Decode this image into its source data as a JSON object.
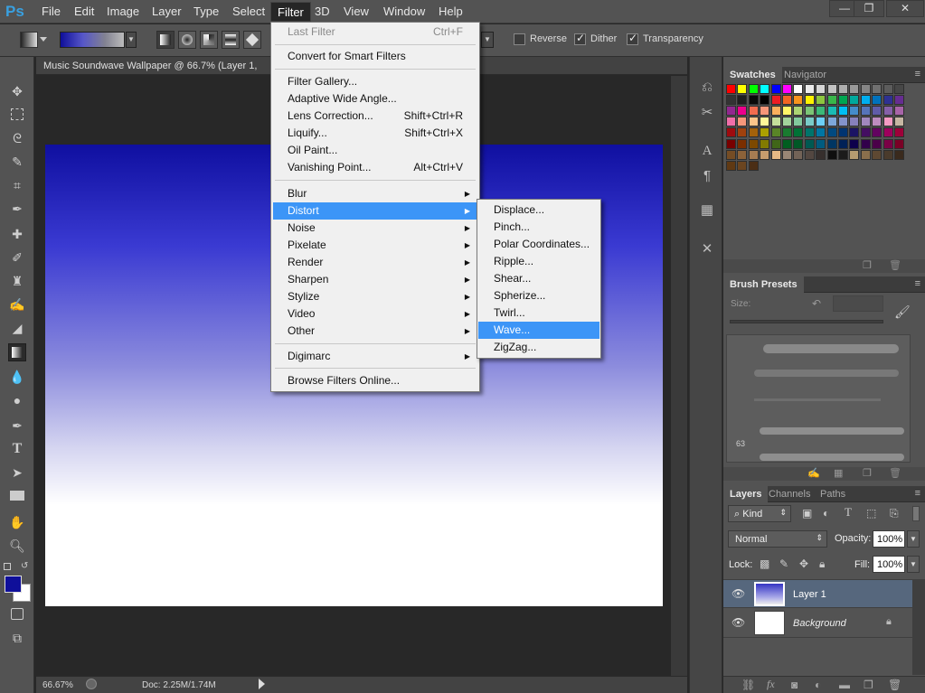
{
  "app": {
    "logo": "Ps"
  },
  "menubar": {
    "items": [
      "File",
      "Edit",
      "Image",
      "Layer",
      "Type",
      "Select",
      "Filter",
      "3D",
      "View",
      "Window",
      "Help"
    ],
    "window_controls": [
      "—",
      "❐",
      "✕"
    ]
  },
  "options": {
    "checkboxes": [
      {
        "label": "Reverse",
        "checked": false
      },
      {
        "label": "Dither",
        "checked": true
      },
      {
        "label": "Transparency",
        "checked": true
      }
    ]
  },
  "document": {
    "tab_title": "Music Soundwave Wallpaper @ 66.7% (Layer 1,",
    "zoom": "66.67%",
    "doc_size": "Doc: 2.25M/1.74M"
  },
  "filter_menu": {
    "items": [
      {
        "label": "Last Filter",
        "shortcut": "Ctrl+F",
        "disabled": true
      },
      {
        "label": "Convert for Smart Filters"
      },
      {
        "label": "Filter Gallery..."
      },
      {
        "label": "Adaptive Wide Angle..."
      },
      {
        "label": "Lens Correction...",
        "shortcut": "Shift+Ctrl+R"
      },
      {
        "label": "Liquify...",
        "shortcut": "Shift+Ctrl+X"
      },
      {
        "label": "Oil Paint..."
      },
      {
        "label": "Vanishing Point...",
        "shortcut": "Alt+Ctrl+V"
      },
      {
        "label": "Blur",
        "submenu": true
      },
      {
        "label": "Distort",
        "submenu": true,
        "highlighted": true
      },
      {
        "label": "Noise",
        "submenu": true
      },
      {
        "label": "Pixelate",
        "submenu": true
      },
      {
        "label": "Render",
        "submenu": true
      },
      {
        "label": "Sharpen",
        "submenu": true
      },
      {
        "label": "Stylize",
        "submenu": true
      },
      {
        "label": "Video",
        "submenu": true
      },
      {
        "label": "Other",
        "submenu": true
      },
      {
        "label": "Digimarc",
        "submenu": true
      },
      {
        "label": "Browse Filters Online..."
      }
    ]
  },
  "distort_submenu": {
    "items": [
      {
        "label": "Displace..."
      },
      {
        "label": "Pinch..."
      },
      {
        "label": "Polar Coordinates..."
      },
      {
        "label": "Ripple..."
      },
      {
        "label": "Shear..."
      },
      {
        "label": "Spherize..."
      },
      {
        "label": "Twirl..."
      },
      {
        "label": "Wave...",
        "highlighted": true
      },
      {
        "label": "ZigZag..."
      }
    ]
  },
  "panels": {
    "swatch_tabs": [
      "Swatches",
      "Navigator"
    ],
    "brush_tab": "Brush Presets",
    "brush_size_label": "Size:",
    "brush_count": "63",
    "layer_tabs": [
      "Layers",
      "Channels",
      "Paths"
    ],
    "kind_label": "Kind",
    "blend_mode": "Normal",
    "opacity_label": "Opacity:",
    "opacity_value": "100%",
    "lock_label": "Lock:",
    "fill_label": "Fill:",
    "fill_value": "100%",
    "layers": [
      {
        "name": "Layer 1",
        "selected": true
      },
      {
        "name": "Background",
        "locked": true
      }
    ]
  },
  "colors": {
    "foreground": "#0f0f9a",
    "background": "#ffffff",
    "menu_highlight": "#3c95f7",
    "swatches": [
      [
        "#ff0000",
        "#ffff00",
        "#00ff00",
        "#00ffff",
        "#0000ff",
        "#ff00ff",
        "#ffffff",
        "#ebebeb",
        "#d6d6d6",
        "#c2c2c2",
        "#adadad",
        "#999999",
        "#858585",
        "#707070",
        "#5c5c5c",
        "#474747"
      ],
      [
        "#333333",
        "#1f1f1f",
        "#0a0a0a",
        "#000000",
        "#ed1c24",
        "#f26522",
        "#f7941d",
        "#fff200",
        "#8dc63f",
        "#39b54a",
        "#00a651",
        "#00a99d",
        "#00aeef",
        "#0072bc",
        "#2e3192",
        "#662d91"
      ],
      [
        "#92278f",
        "#ec008c",
        "#f26c4f",
        "#f69679",
        "#fbaf5d",
        "#fff568",
        "#acd373",
        "#7cc576",
        "#3cb878",
        "#1abbb4",
        "#00bff3",
        "#448ccb",
        "#5674b9",
        "#605ca8",
        "#8560a8",
        "#a864a8"
      ],
      [
        "#f06ea9",
        "#f7977a",
        "#fdc68a",
        "#fff799",
        "#c4df9b",
        "#a3d39c",
        "#82ca9d",
        "#7accc8",
        "#6dcff6",
        "#7da7d9",
        "#8393ca",
        "#8781bd",
        "#a187be",
        "#bd8cbf",
        "#f49ac2",
        "#c6b7a3"
      ],
      [
        "#9e0b0f",
        "#a0410d",
        "#a3620a",
        "#aba000",
        "#598527",
        "#197b30",
        "#007236",
        "#00746b",
        "#0076a3",
        "#004a80",
        "#003471",
        "#1b1464",
        "#440e62",
        "#630460",
        "#9e005d",
        "#9e0039"
      ],
      [
        "#790000",
        "#7b2e00",
        "#7d4900",
        "#827b00",
        "#406618",
        "#005e20",
        "#005826",
        "#005952",
        "#005b7f",
        "#003663",
        "#002157",
        "#0d004c",
        "#32004b",
        "#4b0049",
        "#7b0046",
        "#7a0026"
      ],
      [
        "#754c24",
        "#8c6239",
        "#a67c52",
        "#c69c6d",
        "#e6b985",
        "#998675",
        "#736357",
        "#534741",
        "#362f2d",
        "#0f0f0f",
        "#1b1b1b",
        "#b59b70",
        "#8a6f4c",
        "#5e4832",
        "#4a3b2c",
        "#3a2a1d"
      ],
      [
        "#603913",
        "#6b4520",
        "#4b2e15"
      ]
    ]
  }
}
